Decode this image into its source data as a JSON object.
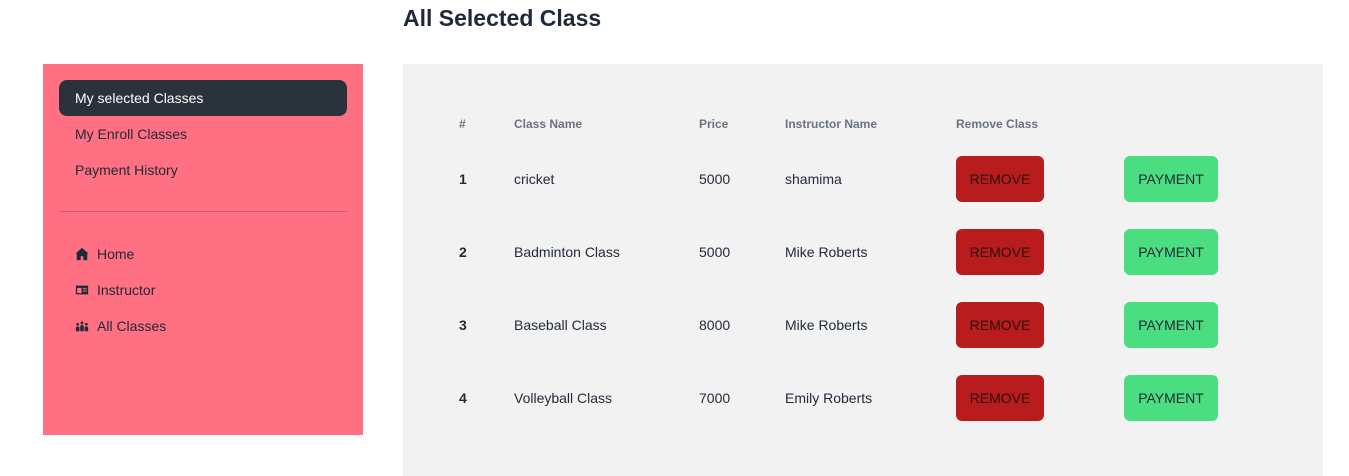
{
  "page": {
    "title": "All Selected Class"
  },
  "sidebar": {
    "menu": [
      {
        "label": "My selected Classes",
        "active": true
      },
      {
        "label": "My Enroll Classes",
        "active": false
      },
      {
        "label": "Payment History",
        "active": false
      }
    ],
    "nav": [
      {
        "label": "Home",
        "icon": "home-icon"
      },
      {
        "label": "Instructor",
        "icon": "id-card-icon"
      },
      {
        "label": "All Classes",
        "icon": "classroom-icon"
      }
    ]
  },
  "table": {
    "headers": [
      "#",
      "Class Name",
      "Price",
      "Instructor Name",
      "Remove Class",
      ""
    ],
    "rows": [
      {
        "index": "1",
        "class_name": "cricket",
        "price": "5000",
        "instructor": "shamima",
        "remove_label": "REMOVE",
        "payment_label": "PAYMENT"
      },
      {
        "index": "2",
        "class_name": "Badminton Class",
        "price": "5000",
        "instructor": "Mike Roberts",
        "remove_label": "REMOVE",
        "payment_label": "PAYMENT"
      },
      {
        "index": "3",
        "class_name": "Baseball Class",
        "price": "8000",
        "instructor": "Mike Roberts",
        "remove_label": "REMOVE",
        "payment_label": "PAYMENT"
      },
      {
        "index": "4",
        "class_name": "Volleyball Class",
        "price": "7000",
        "instructor": "Emily Roberts",
        "remove_label": "REMOVE",
        "payment_label": "PAYMENT"
      }
    ]
  },
  "colors": {
    "sidebar_bg": "#fe7082",
    "active_item_bg": "#2a323c",
    "panel_bg": "#f2f2f2",
    "remove_button": "#b91c1c",
    "payment_button": "#4ade80"
  }
}
